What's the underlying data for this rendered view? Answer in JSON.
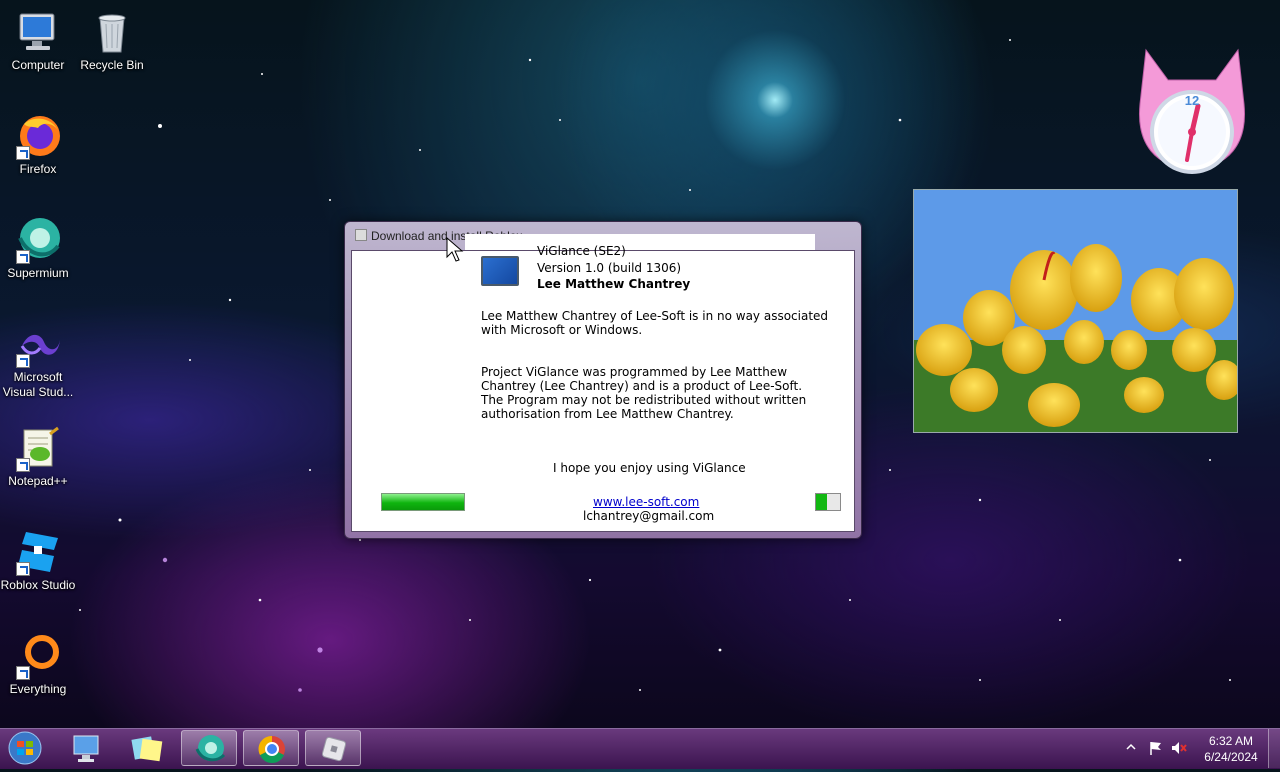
{
  "desktop": {
    "icons": [
      {
        "label": "Computer",
        "icon": "computer-icon"
      },
      {
        "label": "Recycle Bin",
        "icon": "recycle-bin-icon"
      },
      {
        "label": "Firefox",
        "icon": "firefox-icon"
      },
      {
        "label": "Supermium",
        "icon": "supermium-icon"
      },
      {
        "label": "Microsoft Visual Stud...",
        "icon": "visual-studio-icon"
      },
      {
        "label": "Notepad++",
        "icon": "notepad-plus-plus-icon"
      },
      {
        "label": "Roblox Studio",
        "icon": "roblox-studio-icon"
      },
      {
        "label": "Everything",
        "icon": "everything-search-icon"
      }
    ]
  },
  "dialog": {
    "title": "Download and install Roblox",
    "product": "ViGlance (SE2)",
    "version": "Version 1.0 (build 1306)",
    "author": "Lee Matthew Chantrey",
    "disclaimer_1": "Lee Matthew Chantrey of Lee-Soft is in no way associated",
    "disclaimer_2": "with Microsoft or Windows.",
    "about_1": "Project ViGlance was programmed by Lee Matthew",
    "about_2": "Chantrey (Lee Chantrey) and is a product of Lee-Soft.",
    "about_3": "The Program may not be redistributed without written",
    "about_4": "authorisation from Lee Matthew Chantrey.",
    "enjoy": "I hope you enjoy using ViGlance",
    "website": "www.lee-soft.com",
    "email": "lchantrey@gmail.com",
    "progress_left": 1.0,
    "progress_right": 0.45
  },
  "clock_gadget": {
    "number": "12"
  },
  "taskbar": {
    "buttons": [
      "start-orb-icon",
      "remote-desktop-icon",
      "sticky-notes-icon",
      "supermium-icon",
      "chrome-icon",
      "roblox-icon"
    ],
    "time": "6:32 AM",
    "date": "6/24/2024"
  },
  "colors": {
    "taskbar": "#5a2a72",
    "progress_green": "#12b812",
    "link": "#0000cc"
  }
}
